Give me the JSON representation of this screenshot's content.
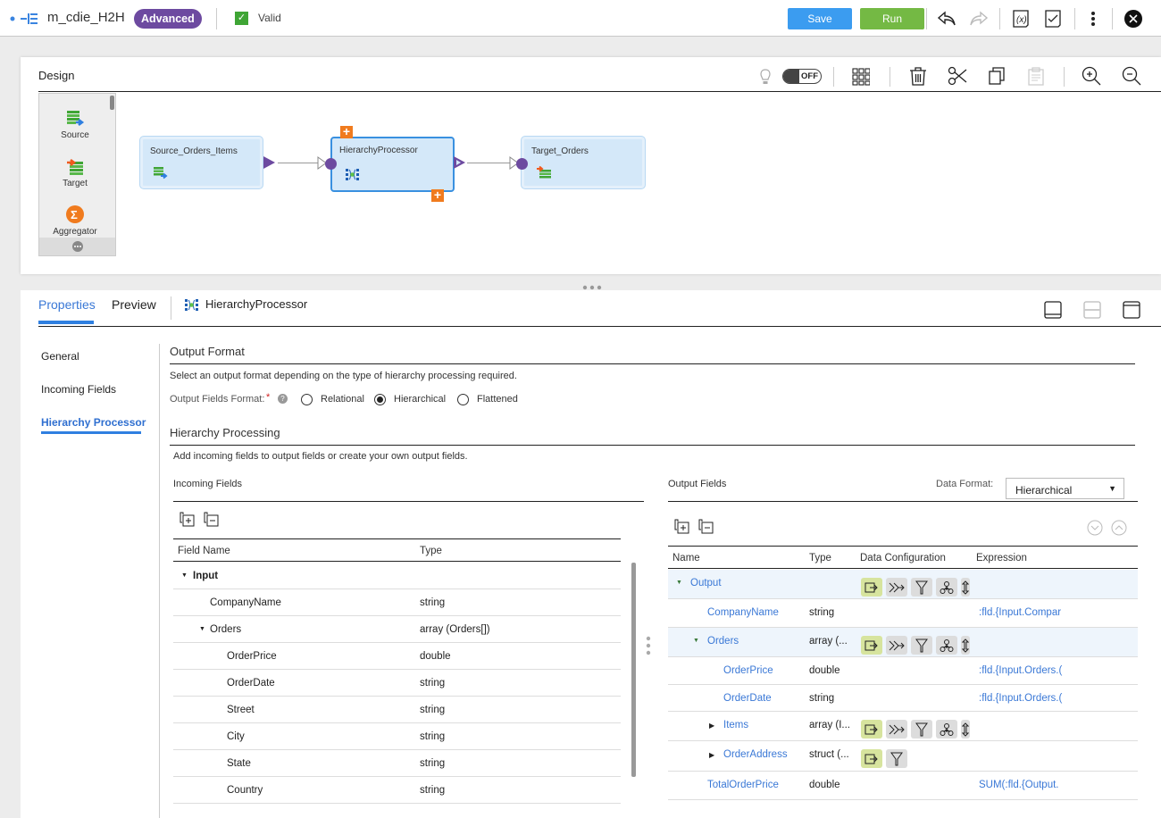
{
  "topbar": {
    "mapping_name": "m_cdie_H2H",
    "badge": "Advanced",
    "status": "Valid",
    "save_label": "Save",
    "run_label": "Run",
    "icons": [
      "mapping-icon",
      "undo-icon",
      "redo-icon",
      "parameters-icon",
      "validate-icon",
      "more-vertical-icon",
      "close-icon"
    ]
  },
  "design": {
    "label": "Design",
    "toggle_label": "OFF",
    "toolbar_icons": [
      "lightbulb-icon",
      "arrange-grid-icon",
      "delete-icon",
      "cut-icon",
      "copy-icon",
      "paste-icon",
      "zoom-in-icon",
      "zoom-out-icon"
    ],
    "palette": [
      {
        "label": "Source",
        "icon": "source-icon"
      },
      {
        "label": "Target",
        "icon": "target-icon"
      },
      {
        "label": "Aggregator",
        "icon": "aggregator-icon"
      }
    ],
    "nodes": [
      {
        "label": "Source_Orders_Items"
      },
      {
        "label": "HierarchyProcessor"
      },
      {
        "label": "Target_Orders"
      }
    ]
  },
  "properties": {
    "tabs": [
      "Properties",
      "Preview"
    ],
    "active_tab": "Properties",
    "object_name": "HierarchyProcessor",
    "side_nav": [
      "General",
      "Incoming Fields",
      "Hierarchy Processor"
    ],
    "active_nav": "Hierarchy Processor",
    "output_format": {
      "heading": "Output Format",
      "description": "Select an output format depending on the type of hierarchy processing required.",
      "field_label": "Output Fields Format:",
      "required_mark": "*",
      "options": [
        "Relational",
        "Hierarchical",
        "Flattened"
      ],
      "selected": "Hierarchical"
    },
    "hierarchy_processing": {
      "heading": "Hierarchy Processing",
      "description": "Add incoming fields to output fields or create your own output fields."
    },
    "incoming": {
      "title": "Incoming Fields",
      "columns": [
        "Field Name",
        "Type"
      ],
      "rows": [
        {
          "name": "Input",
          "type": "",
          "level": 0,
          "expanded": true
        },
        {
          "name": "CompanyName",
          "type": "string",
          "level": 1
        },
        {
          "name": "Orders",
          "type": "array (Orders[])",
          "level": 1,
          "expanded": true
        },
        {
          "name": "OrderPrice",
          "type": "double",
          "level": 2
        },
        {
          "name": "OrderDate",
          "type": "string",
          "level": 2
        },
        {
          "name": "Street",
          "type": "string",
          "level": 2
        },
        {
          "name": "City",
          "type": "string",
          "level": 2
        },
        {
          "name": "State",
          "type": "string",
          "level": 2
        },
        {
          "name": "Country",
          "type": "string",
          "level": 2
        }
      ]
    },
    "output": {
      "title": "Output Fields",
      "data_format_label": "Data Format:",
      "data_format_value": "Hierarchical",
      "columns": [
        "Name",
        "Type",
        "Data Configuration",
        "Expression"
      ],
      "rows": [
        {
          "name": "Output",
          "type": "",
          "expr": "",
          "toggle": "expanded"
        },
        {
          "name": "CompanyName",
          "type": "string",
          "expr": ":fld.{Input.Compar"
        },
        {
          "name": "Orders",
          "type": "array (...",
          "expr": "",
          "toggle": "expanded"
        },
        {
          "name": "OrderPrice",
          "type": "double",
          "expr": ":fld.{Input.Orders.("
        },
        {
          "name": "OrderDate",
          "type": "string",
          "expr": ":fld.{Input.Orders.("
        },
        {
          "name": "Items",
          "type": "array (I...",
          "expr": "",
          "toggle": "collapsed"
        },
        {
          "name": "OrderAddress",
          "type": "struct (...",
          "expr": "",
          "toggle": "collapsed"
        },
        {
          "name": "TotalOrderPrice",
          "type": "double",
          "expr": "SUM(:fld.{Output."
        }
      ]
    }
  }
}
